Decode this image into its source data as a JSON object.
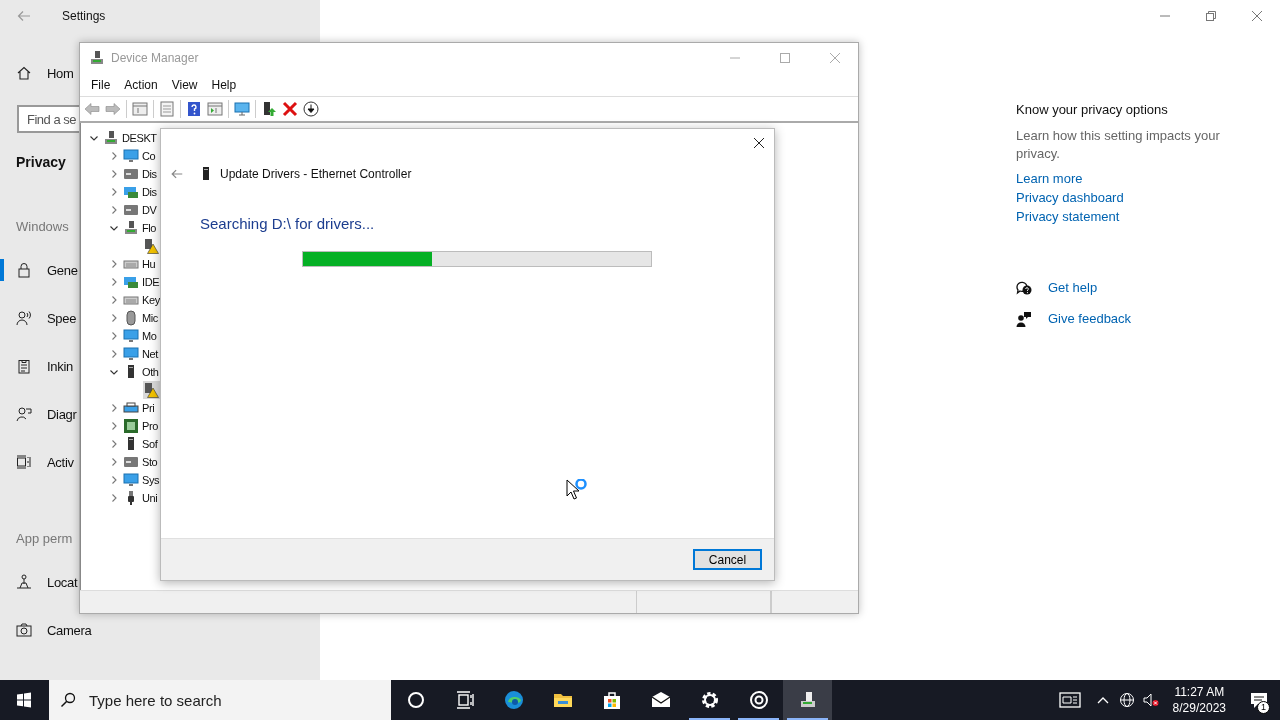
{
  "settings_window": {
    "title": "Settings",
    "sidebar": {
      "home": "Hom",
      "search": {
        "placeholder": "Find a se"
      },
      "heading": "Privacy",
      "sections": [
        {
          "label": "Windows",
          "items": [
            {
              "label": "Gene",
              "kind": "lock",
              "selected": true
            },
            {
              "label": "Spee",
              "kind": "speech",
              "selected": false
            },
            {
              "label": "Inkin",
              "kind": "clipboard",
              "selected": false
            },
            {
              "label": "Diagr",
              "kind": "person",
              "selected": false
            },
            {
              "label": "Activ",
              "kind": "timeline",
              "selected": false
            }
          ]
        },
        {
          "label": "App perm",
          "items": [
            {
              "label": "Locat",
              "kind": "location",
              "selected": false
            },
            {
              "label": "Camera",
              "kind": "camera",
              "selected": false
            }
          ]
        }
      ]
    },
    "side_panel": {
      "heading": "Know your privacy options",
      "description": "Learn how this setting impacts your privacy.",
      "links": [
        "Learn more",
        "Privacy dashboard",
        "Privacy statement"
      ],
      "support": [
        {
          "kind": "help",
          "label": "Get help"
        },
        {
          "kind": "feedback",
          "label": "Give feedback"
        }
      ]
    }
  },
  "device_manager": {
    "title": "Device Manager",
    "menu": [
      "File",
      "Action",
      "View",
      "Help"
    ],
    "tree": {
      "label": "DESKT",
      "kind": "computer",
      "expanded": true,
      "selected": false,
      "children": [
        {
          "label": "Co",
          "kind": "monitor",
          "expanded": false,
          "selected": false
        },
        {
          "label": "Dis",
          "kind": "drive",
          "expanded": false,
          "selected": false
        },
        {
          "label": "Dis",
          "kind": "card",
          "expanded": false,
          "selected": false
        },
        {
          "label": "DV",
          "kind": "drive",
          "expanded": false,
          "selected": false
        },
        {
          "label": "Flo",
          "kind": "computer",
          "expanded": true,
          "selected": false,
          "children": [
            {
              "kind": "warning",
              "selected": false
            }
          ]
        },
        {
          "label": "Hu",
          "kind": "keyboard",
          "expanded": false,
          "selected": false
        },
        {
          "label": "IDE",
          "kind": "card",
          "expanded": false,
          "selected": false
        },
        {
          "label": "Key",
          "kind": "keyboard",
          "expanded": false,
          "selected": false
        },
        {
          "label": "Mic",
          "kind": "mouse",
          "expanded": false,
          "selected": false
        },
        {
          "label": "Mo",
          "kind": "monitor",
          "expanded": false,
          "selected": false
        },
        {
          "label": "Net",
          "kind": "monitor",
          "expanded": false,
          "selected": false
        },
        {
          "label": "Oth",
          "kind": "tower",
          "expanded": true,
          "selected": false,
          "children": [
            {
              "kind": "warning",
              "selected": true
            }
          ]
        },
        {
          "label": "Pri",
          "kind": "printer",
          "expanded": false,
          "selected": false
        },
        {
          "label": "Pro",
          "kind": "chip",
          "expanded": false,
          "selected": false
        },
        {
          "label": "Sof",
          "kind": "tower",
          "expanded": false,
          "selected": false
        },
        {
          "label": "Sto",
          "kind": "drive",
          "expanded": false,
          "selected": false
        },
        {
          "label": "Sys",
          "kind": "monitor",
          "expanded": false,
          "selected": false
        },
        {
          "label": "Uni",
          "kind": "usb",
          "expanded": false,
          "selected": false
        }
      ]
    }
  },
  "dialog": {
    "title": "Update Drivers - Ethernet Controller",
    "status": "Searching D:\\ for drivers...",
    "progress": {
      "level": 0.37
    },
    "buttons": [
      {
        "label": "Cancel",
        "focused": true
      }
    ]
  },
  "taskbar": {
    "search": {
      "placeholder": "Type here to search"
    },
    "apps": [
      {
        "kind": "cortana",
        "running": false,
        "selected": false
      },
      {
        "kind": "task-view",
        "running": false,
        "selected": false
      },
      {
        "kind": "browser",
        "running": false,
        "selected": false
      },
      {
        "kind": "folder",
        "running": false,
        "selected": false
      },
      {
        "kind": "store",
        "running": false,
        "selected": false
      },
      {
        "kind": "mail",
        "running": false,
        "selected": false
      },
      {
        "kind": "settings",
        "running": true,
        "selected": false
      },
      {
        "kind": "media",
        "running": true,
        "selected": false
      },
      {
        "kind": "device-manager",
        "running": true,
        "selected": true
      }
    ],
    "tray": {
      "time": "11:27 AM",
      "date": "8/29/2023",
      "notifications": "1"
    }
  }
}
